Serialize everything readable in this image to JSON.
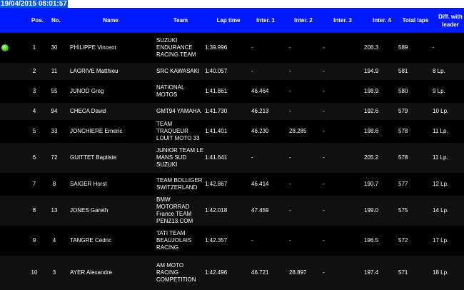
{
  "timestamp": "19/04/2015 08:01:57",
  "headers": {
    "pos": "Pos.",
    "no": "No.",
    "name": "Name",
    "team": "Team",
    "lap": "Lap time",
    "i1": "Inter. 1",
    "i2": "Inter. 2",
    "i3": "Inter. 3",
    "i4": "Inter. 4",
    "tot": "Total laps",
    "diff": "Diff. with leader"
  },
  "rows": [
    {
      "pos": "1",
      "no": "30",
      "name": "PHILIPPE Vincent",
      "team": "SUZUKI ENDURANCE RACING TEAM",
      "lap": "1:39.996",
      "i1": "-",
      "i2": "-",
      "i3": "-",
      "i4": "206.3",
      "tot": "589",
      "diff": "-",
      "flag": true,
      "h": 42
    },
    {
      "pos": "2",
      "no": "11",
      "name": "LAGRIVE Matthieu",
      "team": "SRC KAWASAKI",
      "lap": "1:40.057",
      "i1": "-",
      "i2": "-",
      "i3": "-",
      "i4": "194.9",
      "tot": "581",
      "diff": "8 Lp.",
      "flag": false,
      "h": 24
    },
    {
      "pos": "3",
      "no": "55",
      "name": "JUNOD Greg",
      "team": "NATIONAL MOTOS",
      "lap": "1:41.861",
      "i1": "46.464",
      "i2": "-",
      "i3": "-",
      "i4": "198.9",
      "tot": "580",
      "diff": "9 Lp.",
      "flag": false,
      "h": 32
    },
    {
      "pos": "4",
      "no": "94",
      "name": "CHECA David",
      "team": "GMT94 YAMAHA",
      "lap": "1:41.730",
      "i1": "46.213",
      "i2": "-",
      "i3": "-",
      "i4": "192.6",
      "tot": "579",
      "diff": "10 Lp.",
      "flag": false,
      "h": 24
    },
    {
      "pos": "5",
      "no": "33",
      "name": "JONCHIERE Emeric",
      "team": "TEAM TRAQUEUR LOUIT MOTO 33",
      "lap": "1:41.401",
      "i1": "46.230",
      "i2": "28.285",
      "i3": "-",
      "i4": "198.6",
      "tot": "578",
      "diff": "11 Lp.",
      "flag": false,
      "h": 32
    },
    {
      "pos": "6",
      "no": "72",
      "name": "GUITTET Baptiste",
      "team": "JUNIOR TEAM LE MANS SUD SUZUKI",
      "lap": "1:41.641",
      "i1": "-",
      "i2": "-",
      "i3": "-",
      "i4": "205.2",
      "tot": "578",
      "diff": "11 Lp.",
      "flag": false,
      "h": 42
    },
    {
      "pos": "7",
      "no": "8",
      "name": "SAIGER Horst",
      "team": "TEAM BOLLIGER SWITZERLAND",
      "lap": "1:42.867",
      "i1": "46.414",
      "i2": "-",
      "i3": "-",
      "i4": "190.7",
      "tot": "577",
      "diff": "12 Lp.",
      "flag": false,
      "h": 32
    },
    {
      "pos": "8",
      "no": "13",
      "name": "JONES Gareth",
      "team": "BMW MOTORRAD France TEAM PENZ13.COM",
      "lap": "1:42.018",
      "i1": "47.459",
      "i2": "-",
      "i3": "-",
      "i4": "199.0",
      "tot": "575",
      "diff": "14 Lp.",
      "flag": false,
      "h": 42
    },
    {
      "pos": "9",
      "no": "4",
      "name": "TANGRE Cédric",
      "team": "TATI TEAM BEAUJOLAIS RACING",
      "lap": "1:42.357",
      "i1": "-",
      "i2": "-",
      "i3": "-",
      "i4": "196.5",
      "tot": "572",
      "diff": "17 Lp.",
      "flag": false,
      "h": 42
    },
    {
      "pos": "10",
      "no": "3",
      "name": "AYER Alexandre",
      "team": "AM MOTO RACING COMPETITION",
      "lap": "1:42.496",
      "i1": "46.721",
      "i2": "28.897",
      "i3": "-",
      "i4": "197.4",
      "tot": "571",
      "diff": "18 Lp.",
      "flag": false,
      "h": 48
    }
  ]
}
